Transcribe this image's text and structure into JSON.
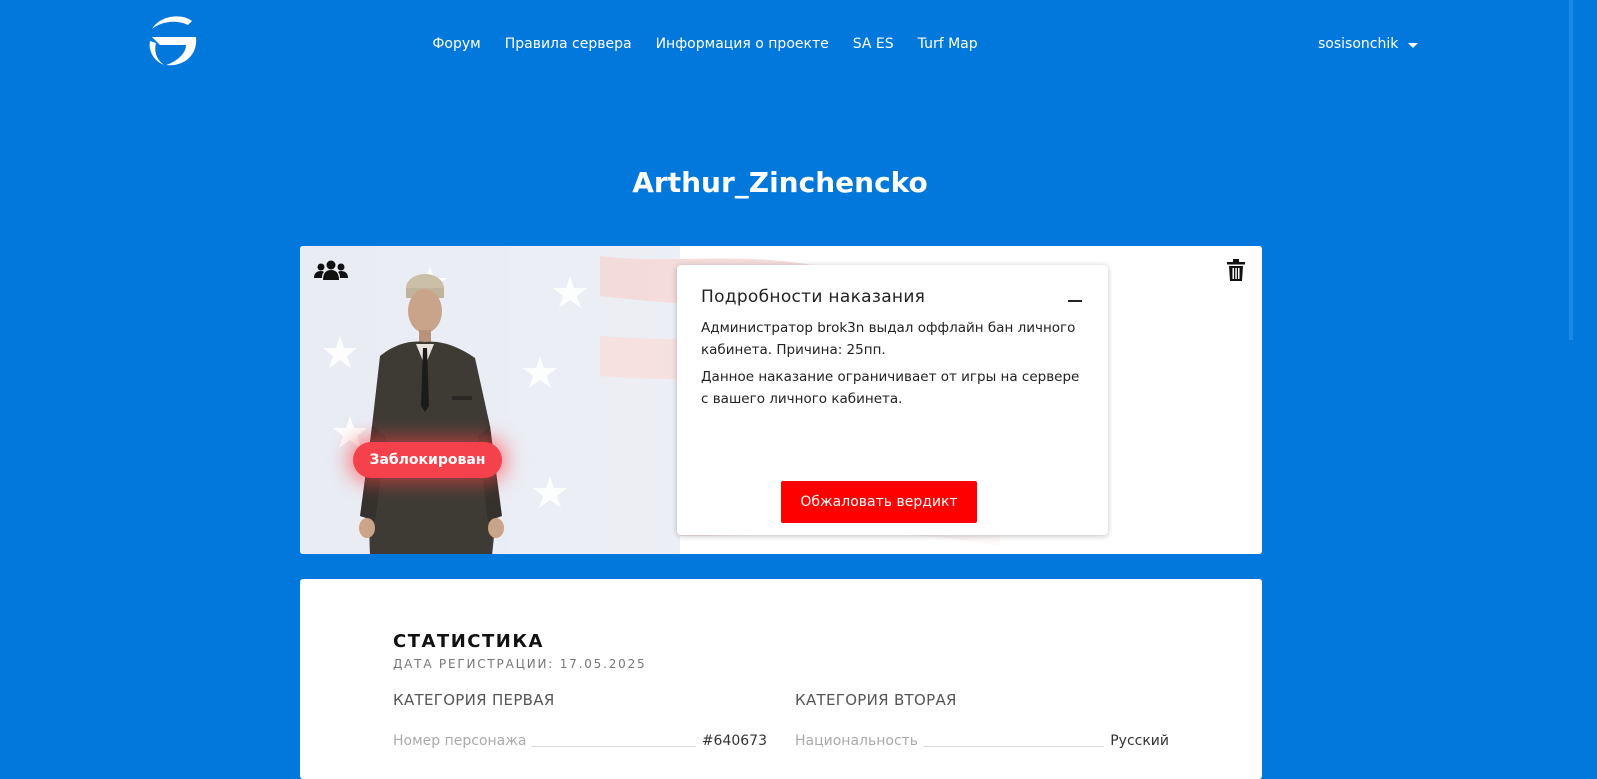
{
  "header": {
    "nav": [
      "Форум",
      "Правила сервера",
      "Информация о проекте",
      "SA ES",
      "Turf Map"
    ],
    "username": "sosisonchik"
  },
  "profile": {
    "name": "Arthur_Zinchencko",
    "status_badge": "Заблокирован",
    "punishment": {
      "title": "Подробности наказания",
      "text1": "Администратор brok3n выдал оффлайн бан личного кабинета. Причина: 25пп.",
      "text2": "Данное наказание ограничивает от игры на сервере с вашего личного кабинета.",
      "appeal_label": "Обжаловать вердикт"
    }
  },
  "stats": {
    "title": "СТАТИСТИКА",
    "registration": "ДАТА РЕГИСТРАЦИИ: 17.05.2025",
    "category1": {
      "title": "КАТЕГОРИЯ ПЕРВАЯ",
      "label": "Номер персонажа",
      "value": "#640673"
    },
    "category2": {
      "title": "КАТЕГОРИЯ ВТОРАЯ",
      "label": "Национальность",
      "value": "Русский"
    }
  },
  "colors": {
    "background": "#0277dc",
    "badge": "#f5414b",
    "appeal_button": "#ff0000"
  },
  "icons": [
    "logo-icon",
    "group-icon",
    "trash-icon",
    "minus-icon",
    "chevron-down-icon"
  ]
}
